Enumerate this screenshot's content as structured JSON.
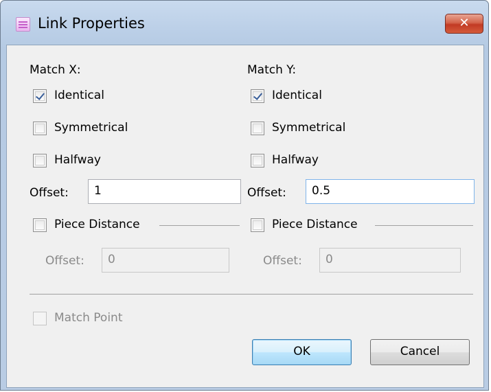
{
  "window": {
    "title": "Link Properties",
    "close_label": "✕"
  },
  "match_x": {
    "heading": "Match X:",
    "identical": {
      "label": "Identical",
      "checked": true
    },
    "symmetrical": {
      "label": "Symmetrical",
      "checked": false
    },
    "halfway": {
      "label": "Halfway",
      "checked": false
    },
    "offset_label": "Offset:",
    "offset_value": "1",
    "piece_distance": {
      "label": "Piece Distance",
      "checked": false
    },
    "pd_offset_label": "Offset:",
    "pd_offset_value": "0"
  },
  "match_y": {
    "heading": "Match Y:",
    "identical": {
      "label": "Identical",
      "checked": true
    },
    "symmetrical": {
      "label": "Symmetrical",
      "checked": false
    },
    "halfway": {
      "label": "Halfway",
      "checked": false
    },
    "offset_label": "Offset:",
    "offset_value": "0.5",
    "piece_distance": {
      "label": "Piece Distance",
      "checked": false
    },
    "pd_offset_label": "Offset:",
    "pd_offset_value": "0"
  },
  "match_point": {
    "label": "Match Point",
    "checked": false,
    "enabled": false
  },
  "buttons": {
    "ok": "OK",
    "cancel": "Cancel"
  }
}
